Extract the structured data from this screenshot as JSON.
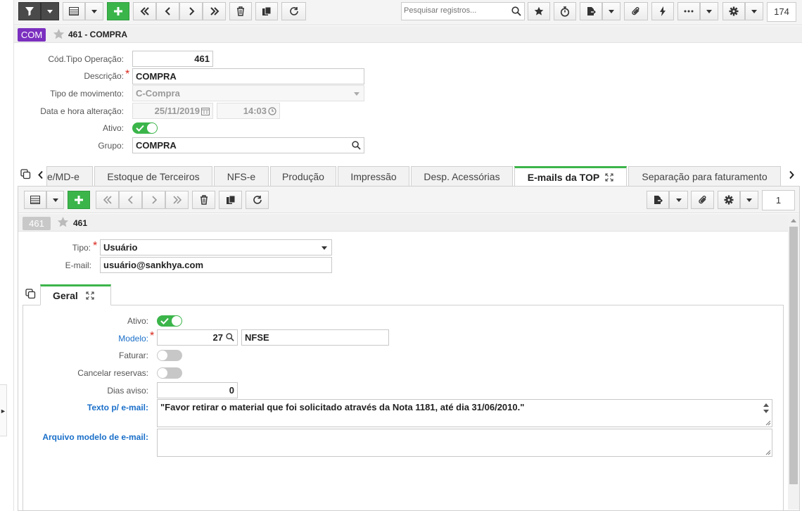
{
  "toolbar": {
    "search_placeholder": "Pesquisar registros...",
    "record_count": "174"
  },
  "header": {
    "badge": "COM",
    "title": "461 - COMPRA"
  },
  "form": {
    "cod_label": "Cód.Tipo Operação:",
    "cod_value": "461",
    "descricao_label": "Descrição:",
    "descricao_value": "COMPRA",
    "tipo_mov_label": "Tipo de movimento:",
    "tipo_mov_value": "C-Compra",
    "data_label": "Data e hora alteração:",
    "data_value": "25/11/2019",
    "hora_value": "14:03",
    "ativo_label": "Ativo:",
    "grupo_label": "Grupo:",
    "grupo_value": "COMPRA"
  },
  "tabs": [
    {
      "label": "e/MD-e"
    },
    {
      "label": "Estoque de Terceiros"
    },
    {
      "label": "NFS-e"
    },
    {
      "label": "Produção"
    },
    {
      "label": "Impressão"
    },
    {
      "label": "Desp. Acessórias"
    },
    {
      "label": "E-mails da TOP"
    },
    {
      "label": "Separação para faturamento"
    }
  ],
  "detail": {
    "record_count": "1",
    "badge": "461",
    "title": "461",
    "tipo_label": "Tipo:",
    "tipo_value": "Usuário",
    "email_label": "E-mail:",
    "email_value": "usuário@sankhya.com",
    "subtab": "Geral",
    "ativo_label": "Ativo:",
    "modelo_label": "Modelo:",
    "modelo_code": "27",
    "modelo_desc": "NFSE",
    "faturar_label": "Faturar:",
    "cancelar_label": "Cancelar reservas:",
    "dias_label": "Dias aviso:",
    "dias_value": "0",
    "texto_label": "Texto p/ e-mail:",
    "texto_value": "\"Favor retirar o material que foi solicitado através da Nota 1181, até dia 31/06/2010.\"",
    "arquivo_label": "Arquivo modelo de e-mail:"
  },
  "colors": {
    "accent_green": "#3bb54a",
    "badge_purple": "#7b2fbf",
    "label_blue": "#1a6fc9",
    "required_red": "#d9261c"
  }
}
